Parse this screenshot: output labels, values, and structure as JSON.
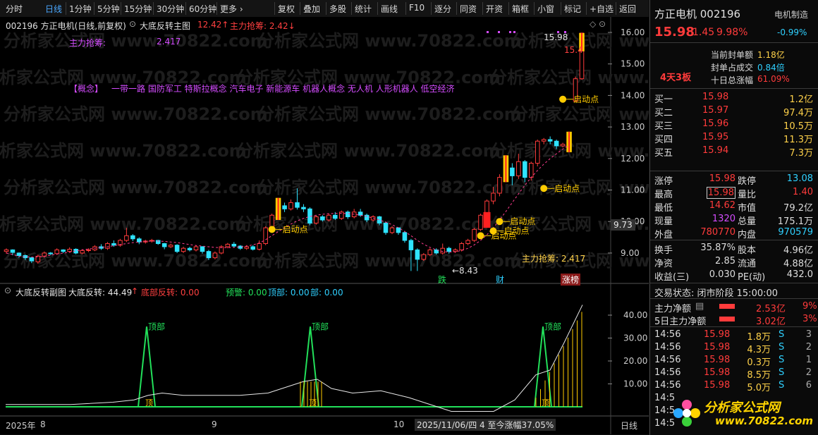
{
  "toolbar": {
    "left_items": [
      "分时",
      "日线",
      "1分钟",
      "5分钟",
      "15分钟",
      "30分钟",
      "60分钟",
      "更多 ›"
    ],
    "right_items": [
      "复权",
      "叠加",
      "多股",
      "统计",
      "画线",
      "F10",
      "逐分",
      "同资",
      "开资",
      "箱框",
      "小窗",
      "标记",
      "+自选",
      "返回"
    ]
  },
  "main_chart": {
    "header_code_name": "002196 方正电机(日线,前复权)",
    "indicator_name": "大底反转主图",
    "indicator_val1": "12.42↑",
    "indicator_val2": "主力抢筹: 2.42↓",
    "zhuli_label": "主力抢筹:",
    "zhuli_value": "2.417",
    "concept_label": "【概念】",
    "concepts": "一带一路 国防军工 特斯拉概念 汽车电子 新能源车 机器人概念 无人机 人形机器人 低空经济",
    "price_axis": [
      "16.00",
      "15.00",
      "14.00",
      "13.00",
      "12.00",
      "11.00",
      "10.00",
      "9.00"
    ],
    "price_tag": "9.73",
    "high_label": "15.98",
    "high_label2": "15.4",
    "low_label": "←8.43",
    "start_label": "启动点",
    "zhuli_bottom": "主力抢筹: 2.417",
    "event_tags": [
      "跌",
      "财",
      "涨榜"
    ],
    "watermark": "分析家公式网 www.70822.com"
  },
  "sub_chart": {
    "title": "大底反转副图",
    "label1": "大底反转: 44.49",
    "label1_arrow": "↑",
    "label2": "底部反转: 0.00",
    "label3": "预警: 0.00",
    "label4": "顶部: 0.00",
    "label5": "部: 0.00",
    "axis": [
      "40.00",
      "30.00",
      "20.00",
      "10.00"
    ],
    "top_label": "顶部",
    "bottom_label": "顶"
  },
  "time_axis": {
    "labels": [
      "2025年",
      "8",
      "9",
      "10"
    ],
    "date_info": "2025/11/06/四 4 至今涨幅37.05%",
    "period": "日线"
  },
  "quote": {
    "name_code": "方正电机 002196",
    "sector": "电机制造",
    "sector_pct": "-0.99%",
    "price": "15.98",
    "change": "1.45",
    "change_pct": "9.98%",
    "streak": "4天3板",
    "seal_label": "当前封单额",
    "seal_value": "1.18亿",
    "seal_ratio_label": "封单占成交",
    "seal_ratio_value": "0.84倍",
    "ten_day_label": "十日总涨幅",
    "ten_day_value": "61.09%",
    "bids": [
      {
        "label": "买一",
        "price": "15.98",
        "vol": "1.2亿"
      },
      {
        "label": "买二",
        "price": "15.97",
        "vol": "97.4万"
      },
      {
        "label": "买三",
        "price": "15.96",
        "vol": "10.5万"
      },
      {
        "label": "买四",
        "price": "15.95",
        "vol": "11.3万"
      },
      {
        "label": "买五",
        "price": "15.94",
        "vol": "7.3万"
      }
    ],
    "stats": [
      {
        "l1": "涨停",
        "v1": "15.98",
        "l2": "跌停",
        "v2": "13.08"
      },
      {
        "l1": "最高",
        "v1": "15.98",
        "l2": "量比",
        "v2": "1.40"
      },
      {
        "l1": "最低",
        "v1": "14.62",
        "l2": "市值",
        "v2": "79.2亿"
      },
      {
        "l1": "现量",
        "v1": "1320",
        "l2": "总量",
        "v2": "175.1万"
      },
      {
        "l1": "外盘",
        "v1": "780770",
        "l2": "内盘",
        "v2": "970579"
      }
    ],
    "stats2": [
      {
        "l1": "换手",
        "v1": "35.87%",
        "l2": "股本",
        "v2": "4.96亿"
      },
      {
        "l1": "净资",
        "v1": "2.85",
        "l2": "流通",
        "v2": "4.88亿"
      },
      {
        "l1": "收益(三)",
        "v1": "0.030",
        "l2": "PE(动)",
        "v2": "432.0"
      }
    ],
    "trade_status": "交易状态: 闭市阶段 15:00:00",
    "net_main_label": "主力净额",
    "net_main_value": "2.53亿",
    "net_main_pct": "9%",
    "net5_label": "5日主力净额",
    "net5_value": "3.02亿",
    "net5_pct": "3%",
    "ticks": [
      {
        "time": "14:56",
        "price": "15.98",
        "vol": "1.8万",
        "bs": "S",
        "n": "3"
      },
      {
        "time": "14:56",
        "price": "15.98",
        "vol": "4.3万",
        "bs": "S",
        "n": "2"
      },
      {
        "time": "14:56",
        "price": "15.98",
        "vol": "0.3万",
        "bs": "S",
        "n": "1"
      },
      {
        "time": "14:56",
        "price": "15.98",
        "vol": "8.5万",
        "bs": "S",
        "n": "2"
      },
      {
        "time": "14:56",
        "price": "15.98",
        "vol": "5.0万",
        "bs": "S",
        "n": "6"
      },
      {
        "time": "14:5",
        "price": "",
        "vol": "",
        "bs": "",
        "n": ""
      },
      {
        "time": "14:5",
        "price": "",
        "vol": "",
        "bs": "",
        "n": ""
      },
      {
        "time": "14:5",
        "price": "",
        "vol": "",
        "bs": "",
        "n": ""
      }
    ],
    "logo_text": "分析家公式网",
    "logo_url": "www.70822.com"
  },
  "candles": [
    [
      9.05,
      9.1,
      9.0,
      8.98,
      9.15
    ],
    [
      9.1,
      9.02,
      8.95,
      8.93,
      9.12
    ],
    [
      9.0,
      8.92,
      8.88,
      8.85,
      9.02
    ],
    [
      8.92,
      8.85,
      8.8,
      8.78,
      8.95
    ],
    [
      8.85,
      8.75,
      8.7,
      8.68,
      8.88
    ],
    [
      8.72,
      8.9,
      8.68,
      8.66,
      8.95
    ],
    [
      8.9,
      9.0,
      8.88,
      8.85,
      9.05
    ],
    [
      9.0,
      8.98,
      8.96,
      8.94,
      9.03
    ],
    [
      8.98,
      9.1,
      8.96,
      8.94,
      9.15
    ],
    [
      9.1,
      9.05,
      9.02,
      9.0,
      9.12
    ],
    [
      9.05,
      9.12,
      9.03,
      9.01,
      9.18
    ],
    [
      9.12,
      9.0,
      8.98,
      8.96,
      9.15
    ],
    [
      9.0,
      9.08,
      8.98,
      8.96,
      9.12
    ],
    [
      9.08,
      9.1,
      9.05,
      9.03,
      9.15
    ],
    [
      9.1,
      9.2,
      9.08,
      9.06,
      9.25
    ],
    [
      9.2,
      9.15,
      9.12,
      9.1,
      9.28
    ],
    [
      9.15,
      9.3,
      9.12,
      9.1,
      9.35
    ],
    [
      9.3,
      9.25,
      9.22,
      9.2,
      9.4
    ],
    [
      9.25,
      9.4,
      9.22,
      9.2,
      9.45
    ],
    [
      9.4,
      9.55,
      9.38,
      9.35,
      9.8
    ],
    [
      9.55,
      9.45,
      9.4,
      9.38,
      9.6
    ],
    [
      9.45,
      9.35,
      9.3,
      9.28,
      9.5
    ],
    [
      9.35,
      9.38,
      9.32,
      9.3,
      9.42
    ],
    [
      9.38,
      9.4,
      9.35,
      9.33,
      9.45
    ],
    [
      9.4,
      9.3,
      9.28,
      9.26,
      9.42
    ],
    [
      9.3,
      9.2,
      9.15,
      9.12,
      9.32
    ],
    [
      9.2,
      9.25,
      9.18,
      9.16,
      9.3
    ],
    [
      9.25,
      9.05,
      9.02,
      9.0,
      9.28
    ],
    [
      9.05,
      9.15,
      9.02,
      9.0,
      9.2
    ],
    [
      9.15,
      9.1,
      9.08,
      9.05,
      9.2
    ],
    [
      9.1,
      9.2,
      9.08,
      9.05,
      9.25
    ],
    [
      9.2,
      9.05,
      9.0,
      8.98,
      9.22
    ],
    [
      9.05,
      8.85,
      8.8,
      8.78,
      9.1
    ],
    [
      8.85,
      9.0,
      8.82,
      8.8,
      9.05
    ],
    [
      9.0,
      9.2,
      8.98,
      8.96,
      9.25
    ],
    [
      9.2,
      9.28,
      9.18,
      9.15,
      9.32
    ],
    [
      9.28,
      9.22,
      9.2,
      9.18,
      9.35
    ],
    [
      9.22,
      9.15,
      9.12,
      9.1,
      9.25
    ],
    [
      9.15,
      9.2,
      9.12,
      9.1,
      9.25
    ],
    [
      9.2,
      9.12,
      9.1,
      9.08,
      9.25
    ],
    [
      9.12,
      9.3,
      9.1,
      9.08,
      9.4
    ],
    [
      9.3,
      9.8,
      9.28,
      9.25,
      9.85
    ],
    [
      9.8,
      10.2,
      9.78,
      9.75,
      10.25
    ],
    [
      10.2,
      10.5,
      10.15,
      10.1,
      10.75
    ],
    [
      10.5,
      10.4,
      10.35,
      10.3,
      10.6
    ],
    [
      10.4,
      10.6,
      10.38,
      10.35,
      10.7
    ],
    [
      10.6,
      10.45,
      10.4,
      10.38,
      11.05
    ],
    [
      10.45,
      10.4,
      10.35,
      10.3,
      10.55
    ],
    [
      10.4,
      9.95,
      9.9,
      9.88,
      10.45
    ],
    [
      9.95,
      10.15,
      9.92,
      9.9,
      10.2
    ],
    [
      10.15,
      10.05,
      10.02,
      10.0,
      10.2
    ],
    [
      10.05,
      10.2,
      10.02,
      10.0,
      10.25
    ],
    [
      10.2,
      10.1,
      10.08,
      10.05,
      10.3
    ],
    [
      10.1,
      10.3,
      10.08,
      10.05,
      10.35
    ],
    [
      10.3,
      10.15,
      10.1,
      10.08,
      10.35
    ],
    [
      10.15,
      10.3,
      10.12,
      10.1,
      10.4
    ],
    [
      10.3,
      10.2,
      10.18,
      10.15,
      10.4
    ],
    [
      10.2,
      10.05,
      10.0,
      9.98,
      10.25
    ],
    [
      10.05,
      10.15,
      10.02,
      10.0,
      10.2
    ],
    [
      10.15,
      9.95,
      9.9,
      9.88,
      10.18
    ],
    [
      9.95,
      9.65,
      9.6,
      9.58,
      10.0
    ],
    [
      9.65,
      9.8,
      9.62,
      9.6,
      9.85
    ],
    [
      9.8,
      9.65,
      9.6,
      9.58,
      9.82
    ],
    [
      9.65,
      9.4,
      9.35,
      9.33,
      9.7
    ],
    [
      9.4,
      9.1,
      8.45,
      8.43,
      9.45
    ],
    [
      9.1,
      8.8,
      8.75,
      8.43,
      9.15
    ],
    [
      8.8,
      8.95,
      8.78,
      8.75,
      9.0
    ],
    [
      8.95,
      9.1,
      8.92,
      8.9,
      9.15
    ],
    [
      9.1,
      9.0,
      8.98,
      8.95,
      9.15
    ],
    [
      9.0,
      9.15,
      8.98,
      8.95,
      9.3
    ],
    [
      9.15,
      9.05,
      9.0,
      8.98,
      9.2
    ],
    [
      9.05,
      9.1,
      9.02,
      9.0,
      9.15
    ],
    [
      9.1,
      9.3,
      9.08,
      9.05,
      9.35
    ],
    [
      9.3,
      9.4,
      9.28,
      9.25,
      9.45
    ],
    [
      9.4,
      9.75,
      9.38,
      9.35,
      9.8
    ],
    [
      9.75,
      10.2,
      9.72,
      9.7,
      10.25
    ],
    [
      10.2,
      10.65,
      10.18,
      10.15,
      10.7
    ],
    [
      10.65,
      10.9,
      10.6,
      10.55,
      11.1
    ],
    [
      10.9,
      11.4,
      10.85,
      10.8,
      11.5
    ],
    [
      11.4,
      11.7,
      11.35,
      11.3,
      12.1
    ],
    [
      11.7,
      11.45,
      11.2,
      11.15,
      11.85
    ],
    [
      11.45,
      11.9,
      11.4,
      11.35,
      12.15
    ],
    [
      11.9,
      11.4,
      11.3,
      11.25,
      11.95
    ],
    [
      11.4,
      11.85,
      11.35,
      11.3,
      11.9
    ],
    [
      11.85,
      12.55,
      11.8,
      11.75,
      12.6
    ],
    [
      12.55,
      12.6,
      12.5,
      12.45,
      12.65
    ],
    [
      12.6,
      12.55,
      12.5,
      12.45,
      12.7
    ],
    [
      12.55,
      12.4,
      12.35,
      12.3,
      12.6
    ],
    [
      12.4,
      12.45,
      12.38,
      12.35,
      12.5
    ],
    [
      12.45,
      12.42,
      12.4,
      12.38,
      12.48
    ],
    [
      13.82,
      14.53,
      13.82,
      13.8,
      14.6
    ],
    [
      14.53,
      15.98,
      14.53,
      14.5,
      15.98
    ]
  ]
}
